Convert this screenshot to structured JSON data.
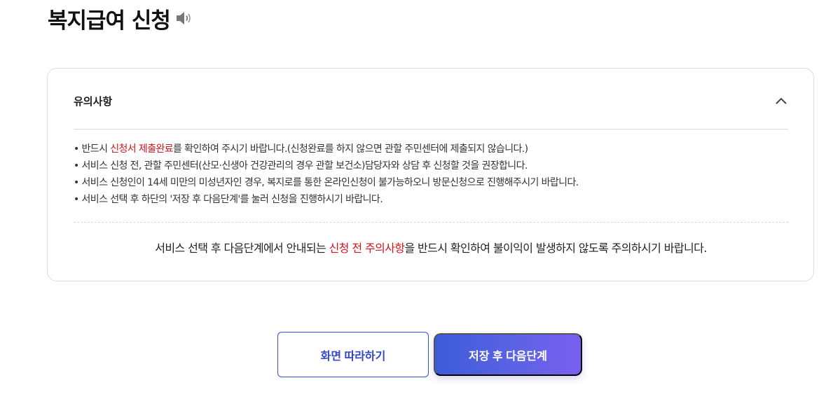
{
  "header": {
    "title": "복지급여 신청"
  },
  "notice": {
    "title": "유의사항",
    "items": [
      {
        "pre": "반드시 ",
        "highlight": "신청서 제출완료",
        "post": "를 확인하여 주시기 바랍니다.(신청완료를 하지 않으면 관할 주민센터에 제출되지 않습니다.)"
      },
      {
        "pre": "서비스 신청 전, 관할 주민센터(산모·신생아 건강관리의 경우 관할 보건소)담당자와 상담 후 신청할 것을 권장합니다.",
        "highlight": "",
        "post": ""
      },
      {
        "pre": "서비스 신청인이 14세 미만의 미성년자인 경우, 복지로를 통한 온라인신청이 불가능하오니 방문신청으로 진행해주시기 바랍니다.",
        "highlight": "",
        "post": ""
      },
      {
        "pre": "서비스 선택 후 하단의 '저장 후 다음단계'를 눌러 신청을 진행하시기 바랍니다.",
        "highlight": "",
        "post": ""
      }
    ],
    "summary": {
      "pre": "서비스 선택 후 다음단계에서 안내되는 ",
      "highlight": "신청 전 주의사항",
      "post": "을 반드시 확인하여 불이익이 발생하지 않도록 주의하시기 바랍니다."
    }
  },
  "buttons": {
    "follow_label": "화면 따라하기",
    "next_label": "저장 후 다음단계"
  },
  "colors": {
    "accent_red": "#d2141c",
    "primary_blue": "#3c5bd9",
    "primary_purple": "#7a5ff0",
    "outline_blue": "#3a4fd8"
  },
  "icons": {
    "speaker": "speaker-icon",
    "collapse": "chevron-up-icon"
  }
}
